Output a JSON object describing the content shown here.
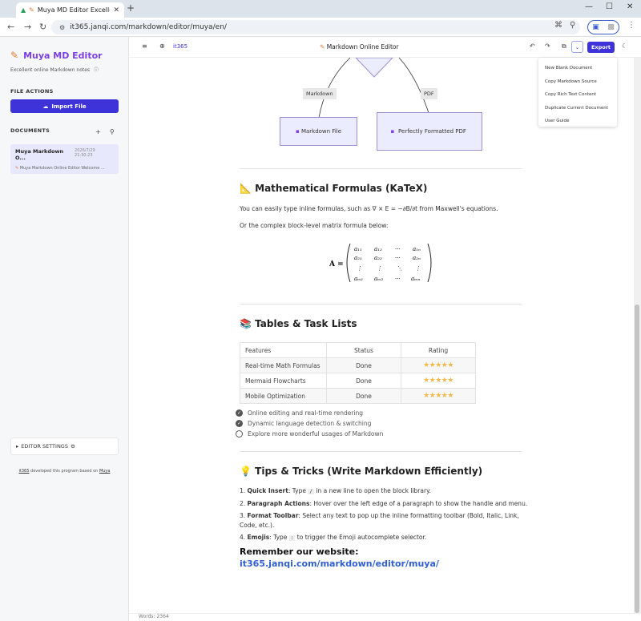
{
  "browser": {
    "tab_title": "Muya MD Editor Excellent",
    "url": "it365.janqi.com/markdown/editor/muya/en/"
  },
  "sidebar": {
    "app_name": "Muya MD Editor",
    "tagline": "Excellent online Markdown notes",
    "file_actions_title": "FILE ACTIONS",
    "import_label": "Import File",
    "documents_title": "DOCUMENTS",
    "doc_card": {
      "title": "Muya Markdown O...",
      "date": "2026/7/29 21:30:23",
      "snippet": "Muya Markdown Online Editor Welcome ..."
    },
    "settings_label": "EDITOR SETTINGS",
    "footer": {
      "brand": "it365",
      "text": "developed this program based on",
      "link": "Muya"
    }
  },
  "topbar": {
    "brand": "it365",
    "title": "Markdown Online Editor",
    "export_label": "Export"
  },
  "dropdown": {
    "items": [
      "New Blank Document",
      "Copy Markdown Source",
      "Copy Rich Text Content",
      "Duplicate Current Document",
      "User Guide"
    ]
  },
  "content": {
    "flow": {
      "label_markdown": "Markdown",
      "label_pdf": "PDF",
      "box_markdown": "Markdown File",
      "box_pdf": "Perfectly Formatted PDF"
    },
    "math": {
      "heading": "Mathematical Formulas (KaTeX)",
      "inline_text": "You can easily type inline formulas, such as ∇ × E = −∂B/∂t from Maxwell's equations.",
      "block_text": "Or the complex block-level matrix formula below:"
    },
    "tables": {
      "heading": "Tables & Task Lists",
      "headers": [
        "Features",
        "Status",
        "Rating"
      ],
      "rows": [
        {
          "feature": "Real-time Math Formulas",
          "status": "Done",
          "rating": "★★★★★"
        },
        {
          "feature": "Mermaid Flowcharts",
          "status": "Done",
          "rating": "★★★★★"
        },
        {
          "feature": "Mobile Optimization",
          "status": "Done",
          "rating": "★★★★★"
        }
      ],
      "tasks": [
        {
          "text": "Online editing and real-time rendering",
          "done": true
        },
        {
          "text": "Dynamic language detection & switching",
          "done": true
        },
        {
          "text": "Explore more wonderful usages of Markdown",
          "done": false
        }
      ]
    },
    "tips": {
      "heading": "Tips & Tricks (Write Markdown Efficiently)",
      "items": [
        {
          "n": "1.",
          "bold": "Quick Insert",
          "text": ": Type",
          "code": "/",
          "rest": " in a new line to open the block library."
        },
        {
          "n": "2.",
          "bold": "Paragraph Actions",
          "text": ": Hover over the left edge of a paragraph to show the handle and menu.",
          "code": "",
          "rest": ""
        },
        {
          "n": "3.",
          "bold": "Format Toolbar",
          "text": ": Select any text to pop up the inline formatting toolbar (Bold, Italic, Link, Code, etc.).",
          "code": "",
          "rest": ""
        },
        {
          "n": "4.",
          "bold": "Emojis",
          "text": ": Type",
          "code": ":",
          "rest": " to trigger the Emoji autocomplete selector."
        }
      ],
      "remember": "Remember our website:",
      "site": "it365.janqi.com/markdown/editor/muya/"
    }
  },
  "status": {
    "words": "Words: 2364"
  }
}
